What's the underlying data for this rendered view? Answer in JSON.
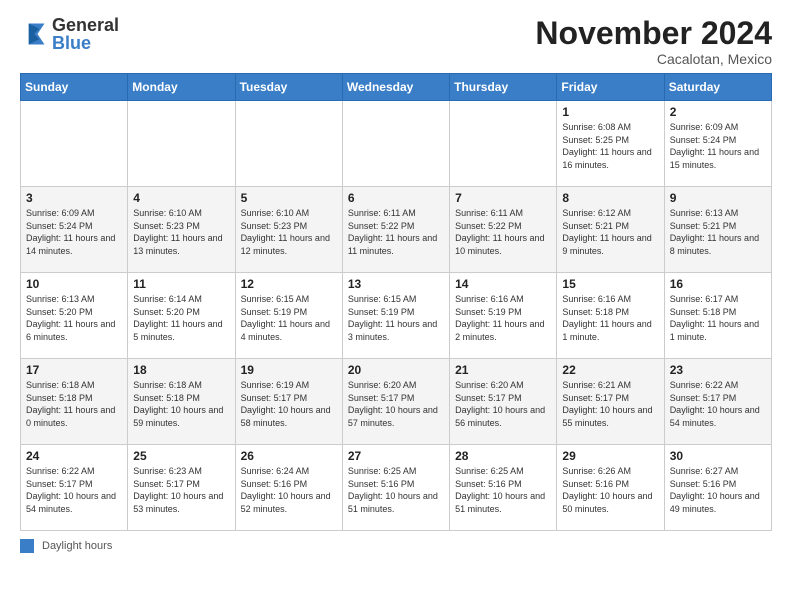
{
  "header": {
    "logo_general": "General",
    "logo_blue": "Blue",
    "month_title": "November 2024",
    "location": "Cacalotan, Mexico"
  },
  "footer": {
    "label": "Daylight hours"
  },
  "weekdays": [
    "Sunday",
    "Monday",
    "Tuesday",
    "Wednesday",
    "Thursday",
    "Friday",
    "Saturday"
  ],
  "weeks": [
    [
      {
        "day": "",
        "info": ""
      },
      {
        "day": "",
        "info": ""
      },
      {
        "day": "",
        "info": ""
      },
      {
        "day": "",
        "info": ""
      },
      {
        "day": "",
        "info": ""
      },
      {
        "day": "1",
        "info": "Sunrise: 6:08 AM\nSunset: 5:25 PM\nDaylight: 11 hours and 16 minutes."
      },
      {
        "day": "2",
        "info": "Sunrise: 6:09 AM\nSunset: 5:24 PM\nDaylight: 11 hours and 15 minutes."
      }
    ],
    [
      {
        "day": "3",
        "info": "Sunrise: 6:09 AM\nSunset: 5:24 PM\nDaylight: 11 hours and 14 minutes."
      },
      {
        "day": "4",
        "info": "Sunrise: 6:10 AM\nSunset: 5:23 PM\nDaylight: 11 hours and 13 minutes."
      },
      {
        "day": "5",
        "info": "Sunrise: 6:10 AM\nSunset: 5:23 PM\nDaylight: 11 hours and 12 minutes."
      },
      {
        "day": "6",
        "info": "Sunrise: 6:11 AM\nSunset: 5:22 PM\nDaylight: 11 hours and 11 minutes."
      },
      {
        "day": "7",
        "info": "Sunrise: 6:11 AM\nSunset: 5:22 PM\nDaylight: 11 hours and 10 minutes."
      },
      {
        "day": "8",
        "info": "Sunrise: 6:12 AM\nSunset: 5:21 PM\nDaylight: 11 hours and 9 minutes."
      },
      {
        "day": "9",
        "info": "Sunrise: 6:13 AM\nSunset: 5:21 PM\nDaylight: 11 hours and 8 minutes."
      }
    ],
    [
      {
        "day": "10",
        "info": "Sunrise: 6:13 AM\nSunset: 5:20 PM\nDaylight: 11 hours and 6 minutes."
      },
      {
        "day": "11",
        "info": "Sunrise: 6:14 AM\nSunset: 5:20 PM\nDaylight: 11 hours and 5 minutes."
      },
      {
        "day": "12",
        "info": "Sunrise: 6:15 AM\nSunset: 5:19 PM\nDaylight: 11 hours and 4 minutes."
      },
      {
        "day": "13",
        "info": "Sunrise: 6:15 AM\nSunset: 5:19 PM\nDaylight: 11 hours and 3 minutes."
      },
      {
        "day": "14",
        "info": "Sunrise: 6:16 AM\nSunset: 5:19 PM\nDaylight: 11 hours and 2 minutes."
      },
      {
        "day": "15",
        "info": "Sunrise: 6:16 AM\nSunset: 5:18 PM\nDaylight: 11 hours and 1 minute."
      },
      {
        "day": "16",
        "info": "Sunrise: 6:17 AM\nSunset: 5:18 PM\nDaylight: 11 hours and 1 minute."
      }
    ],
    [
      {
        "day": "17",
        "info": "Sunrise: 6:18 AM\nSunset: 5:18 PM\nDaylight: 11 hours and 0 minutes."
      },
      {
        "day": "18",
        "info": "Sunrise: 6:18 AM\nSunset: 5:18 PM\nDaylight: 10 hours and 59 minutes."
      },
      {
        "day": "19",
        "info": "Sunrise: 6:19 AM\nSunset: 5:17 PM\nDaylight: 10 hours and 58 minutes."
      },
      {
        "day": "20",
        "info": "Sunrise: 6:20 AM\nSunset: 5:17 PM\nDaylight: 10 hours and 57 minutes."
      },
      {
        "day": "21",
        "info": "Sunrise: 6:20 AM\nSunset: 5:17 PM\nDaylight: 10 hours and 56 minutes."
      },
      {
        "day": "22",
        "info": "Sunrise: 6:21 AM\nSunset: 5:17 PM\nDaylight: 10 hours and 55 minutes."
      },
      {
        "day": "23",
        "info": "Sunrise: 6:22 AM\nSunset: 5:17 PM\nDaylight: 10 hours and 54 minutes."
      }
    ],
    [
      {
        "day": "24",
        "info": "Sunrise: 6:22 AM\nSunset: 5:17 PM\nDaylight: 10 hours and 54 minutes."
      },
      {
        "day": "25",
        "info": "Sunrise: 6:23 AM\nSunset: 5:17 PM\nDaylight: 10 hours and 53 minutes."
      },
      {
        "day": "26",
        "info": "Sunrise: 6:24 AM\nSunset: 5:16 PM\nDaylight: 10 hours and 52 minutes."
      },
      {
        "day": "27",
        "info": "Sunrise: 6:25 AM\nSunset: 5:16 PM\nDaylight: 10 hours and 51 minutes."
      },
      {
        "day": "28",
        "info": "Sunrise: 6:25 AM\nSunset: 5:16 PM\nDaylight: 10 hours and 51 minutes."
      },
      {
        "day": "29",
        "info": "Sunrise: 6:26 AM\nSunset: 5:16 PM\nDaylight: 10 hours and 50 minutes."
      },
      {
        "day": "30",
        "info": "Sunrise: 6:27 AM\nSunset: 5:16 PM\nDaylight: 10 hours and 49 minutes."
      }
    ]
  ]
}
